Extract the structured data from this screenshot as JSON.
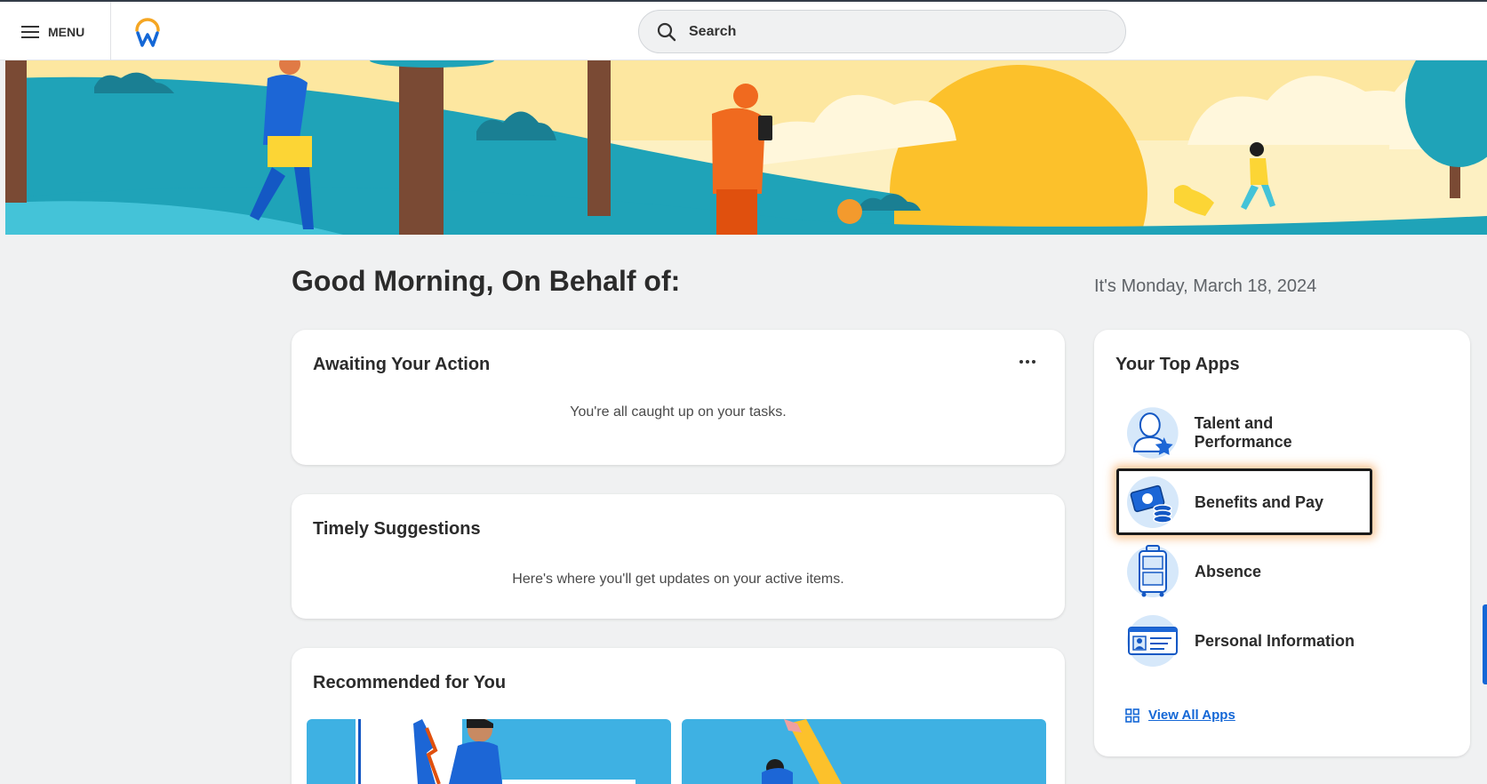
{
  "header": {
    "menu_label": "MENU",
    "search_placeholder": "Search"
  },
  "main": {
    "greeting": "Good Morning, On Behalf of:",
    "date": "It's Monday, March 18, 2024"
  },
  "awaiting": {
    "title": "Awaiting Your Action",
    "message": "You're all caught up on your tasks."
  },
  "suggestions": {
    "title": "Timely Suggestions",
    "message": "Here's where you'll get updates on your active items."
  },
  "recommended": {
    "title": "Recommended for You"
  },
  "top_apps": {
    "title": "Your Top Apps",
    "items": [
      {
        "label": "Talent and Performance",
        "icon": "talent-icon"
      },
      {
        "label": "Benefits and Pay",
        "icon": "benefits-icon"
      },
      {
        "label": "Absence",
        "icon": "absence-icon"
      },
      {
        "label": "Personal Information",
        "icon": "personal-info-icon"
      }
    ],
    "view_all": "View All Apps"
  },
  "colors": {
    "accent_blue": "#1467d6",
    "banner_teal": "#1fa3b8",
    "banner_yellow": "#fcc12b"
  }
}
